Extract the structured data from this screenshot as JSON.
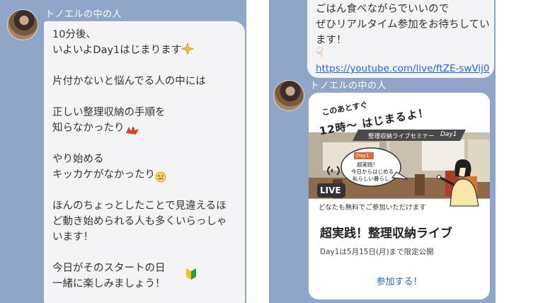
{
  "left": {
    "sender_name": "トノエルの中の人",
    "message": "10分後、\nいよいよDay1はじまります\n\n片付かないと悩んでる人の中には\n\n正しい整理収納の手順を\n知らなかったり\n\nやり始める\nキッカケがなかったり\n\nほんのちょっとしたことで見違えるほ\nど動き始められる人も多くいらっしゃ\nいます！\n\n今日がそのスタートの日\n一緒に楽しみましょう！"
  },
  "right": {
    "message_tail": "ごはん食べながらでいいので\nぜひリアルタイム参加をお待ちしてい\nます！",
    "pointing_emoji": "☟",
    "link_text": "https://youtube.com/live/ftZE-swVij0",
    "sender_name": "トノエルの中の人",
    "card": {
      "banner_soon": "このあとすぐ",
      "banner_time": "12時〜 はじまるよ！",
      "seminar_tag": "整理収納ライブセミナー",
      "day_tag": "Day1",
      "day_label": "Day1",
      "speech_line1": "超実践！",
      "speech_line2": "今日からはじめる",
      "speech_line3": "私らしい暮らし",
      "live_label": "LIVE",
      "free_note": "どなたも無料でご参加いただけます",
      "title": "超実践！整理収納ライブ",
      "subtitle": "Day1は5月15日(月)まで限定公開",
      "join_button": "参加する！"
    }
  },
  "colors": {
    "chat_bg": "#8fa6c9",
    "bubble": "#f4f4f6",
    "link": "#2a63c4"
  }
}
